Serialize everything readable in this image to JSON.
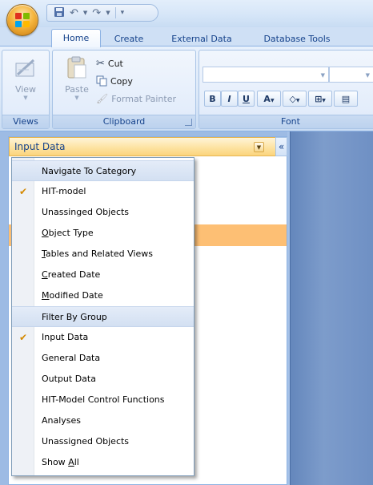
{
  "tabs": [
    {
      "label": "Home"
    },
    {
      "label": "Create"
    },
    {
      "label": "External Data"
    },
    {
      "label": "Database Tools"
    }
  ],
  "ribbon": {
    "views": {
      "view_label": "View",
      "group_label": "Views"
    },
    "clipboard": {
      "paste_label": "Paste",
      "cut_label": "Cut",
      "copy_label": "Copy",
      "format_painter_label": "Format Painter",
      "group_label": "Clipboard"
    },
    "font": {
      "group_label": "Font"
    }
  },
  "nav_pane": {
    "title": "Input Data",
    "shutter_glyph": "«"
  },
  "menu": {
    "header_1": "Navigate To Category",
    "items_1": [
      {
        "label": "HIT-model",
        "checked": true
      },
      {
        "label": "Unassinged Objects",
        "checked": false
      },
      {
        "label": "Object Type",
        "checked": false,
        "ul": 0
      },
      {
        "label": "Tables and Related Views",
        "checked": false,
        "ul": 0
      },
      {
        "label": "Created Date",
        "checked": false,
        "ul": 0
      },
      {
        "label": "Modified Date",
        "checked": false,
        "ul": 0
      }
    ],
    "header_2": "Filter By Group",
    "items_2": [
      {
        "label": "Input Data",
        "checked": true
      },
      {
        "label": "General Data",
        "checked": false
      },
      {
        "label": "Output Data",
        "checked": false
      },
      {
        "label": "HIT-Model Control Functions",
        "checked": false
      },
      {
        "label": "Analyses",
        "checked": false
      },
      {
        "label": "Unassigned Objects",
        "checked": false
      },
      {
        "label": "Show All",
        "checked": false,
        "ul": 5
      }
    ]
  },
  "colors": {
    "accent": "#15428b",
    "selection": "#fdbf74",
    "check": "#d48900"
  }
}
